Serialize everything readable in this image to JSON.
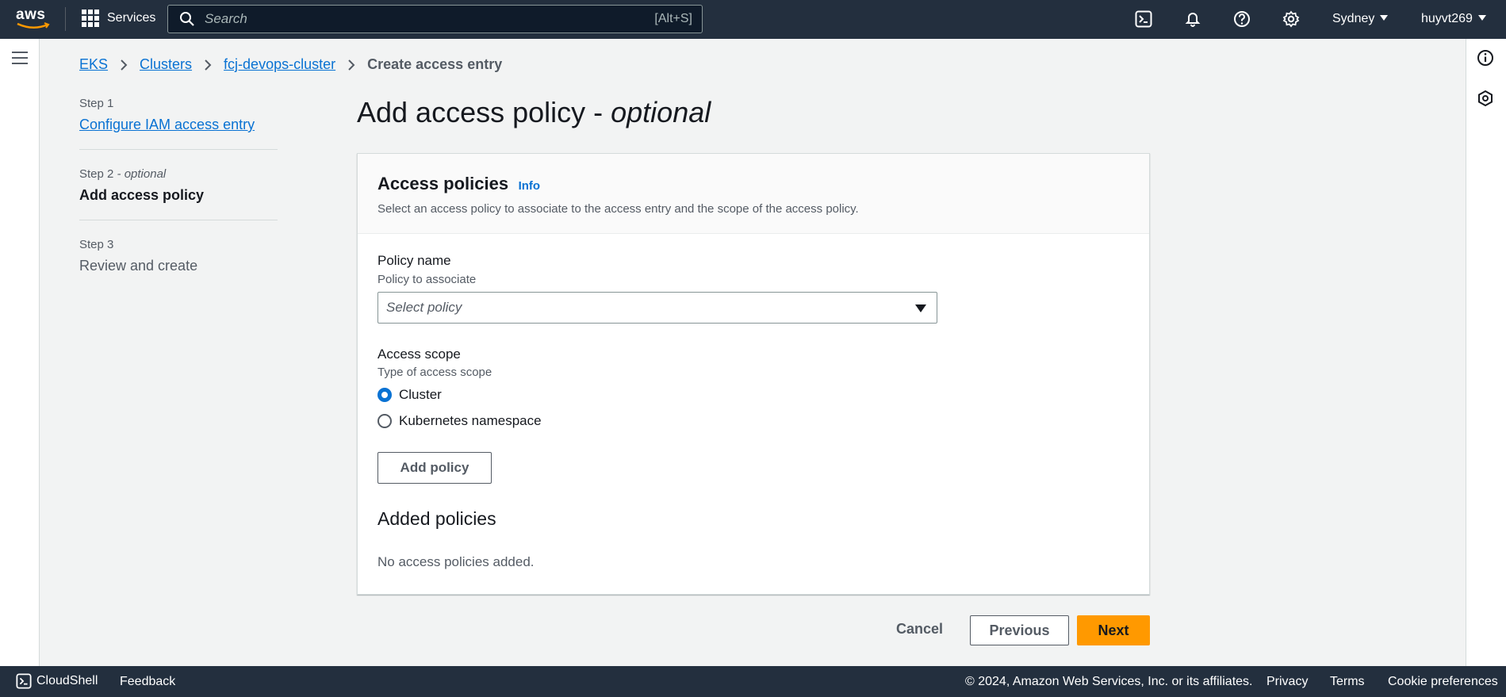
{
  "topnav": {
    "logo_text": "aws",
    "services_label": "Services",
    "search_placeholder": "Search",
    "search_shortcut": "[Alt+S]",
    "region": "Sydney",
    "user": "huyvt269",
    "icons": [
      "cloudshell-icon",
      "bell-icon",
      "help-icon",
      "settings-icon"
    ]
  },
  "breadcrumb": {
    "items": [
      "EKS",
      "Clusters",
      "fcj-devops-cluster"
    ],
    "current": "Create access entry"
  },
  "steps": [
    {
      "num": "Step 1",
      "qualifier": "",
      "label": "Configure IAM access entry",
      "state": "link"
    },
    {
      "num": "Step 2",
      "qualifier": "- optional",
      "label": "Add access policy",
      "state": "active"
    },
    {
      "num": "Step 3",
      "qualifier": "",
      "label": "Review and create",
      "state": "disabled"
    }
  ],
  "page": {
    "title": "Add access policy - ",
    "title_italic": "optional"
  },
  "panel": {
    "title": "Access policies",
    "info": "Info",
    "description": "Select an access policy to associate to the access entry and the scope of the access policy.",
    "policy_label": "Policy name",
    "policy_desc": "Policy to associate",
    "policy_placeholder": "Select policy",
    "scope_label": "Access scope",
    "scope_desc": "Type of access scope",
    "scope_options": [
      {
        "label": "Cluster",
        "checked": true
      },
      {
        "label": "Kubernetes namespace",
        "checked": false
      }
    ],
    "add_policy_button": "Add policy",
    "added_title": "Added policies",
    "empty_text": "No access policies added."
  },
  "actions": {
    "cancel": "Cancel",
    "previous": "Previous",
    "next": "Next"
  },
  "footer": {
    "cloudshell": "CloudShell",
    "feedback": "Feedback",
    "copyright": "© 2024, Amazon Web Services, Inc. or its affiliates.",
    "privacy": "Privacy",
    "terms": "Terms",
    "cookies": "Cookie preferences"
  },
  "colors": {
    "nav_bg": "#232f3e",
    "link": "#0972d3",
    "primary": "#ff9900"
  }
}
